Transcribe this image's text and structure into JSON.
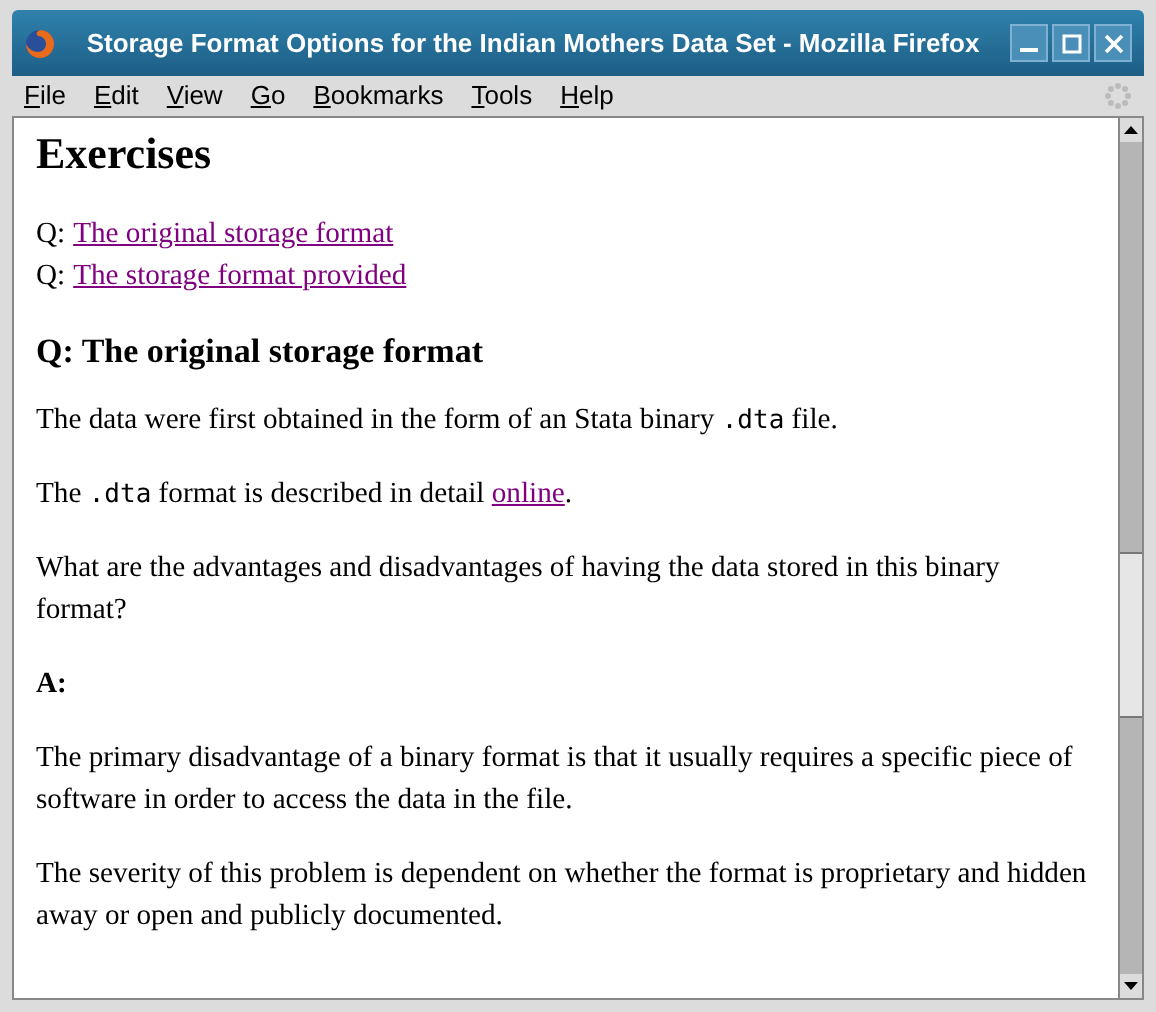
{
  "window": {
    "title": "Storage Format Options for the Indian Mothers Data Set - Mozilla Firefox"
  },
  "menu": [
    "File",
    "Edit",
    "View",
    "Go",
    "Bookmarks",
    "Tools",
    "Help"
  ],
  "page": {
    "heading": "Exercises",
    "questions": [
      {
        "prefix": "Q:",
        "link": "The original storage format"
      },
      {
        "prefix": "Q:",
        "link": "The storage format provided"
      }
    ],
    "section_heading": "Q: The original storage format",
    "paragraphs": [
      {
        "kind": "para",
        "parts": [
          {
            "kind": "text",
            "text": "The data were first obtained in the form of an Stata binary "
          },
          {
            "kind": "code",
            "text": ".dta"
          },
          {
            "kind": "text",
            "text": " file."
          }
        ]
      },
      {
        "kind": "para",
        "parts": [
          {
            "kind": "text",
            "text": "The "
          },
          {
            "kind": "code",
            "text": ".dta"
          },
          {
            "kind": "text",
            "text": " format is described in detail "
          },
          {
            "kind": "link",
            "text": "online"
          },
          {
            "kind": "text",
            "text": "."
          }
        ]
      },
      {
        "kind": "para",
        "parts": [
          {
            "kind": "text",
            "text": "What are the advantages and disadvantages of having the data stored in this binary format?"
          }
        ]
      },
      {
        "kind": "answer",
        "parts": [
          {
            "kind": "text",
            "text": "A:"
          }
        ]
      },
      {
        "kind": "para",
        "parts": [
          {
            "kind": "text",
            "text": "The primary disadvantage of a binary format is that it usually requires a specific piece of software in order to access the data in the file."
          }
        ]
      },
      {
        "kind": "para",
        "parts": [
          {
            "kind": "text",
            "text": "The severity of this problem is dependent on whether the format is proprietary and hidden away or open and publicly documented."
          }
        ]
      }
    ]
  }
}
